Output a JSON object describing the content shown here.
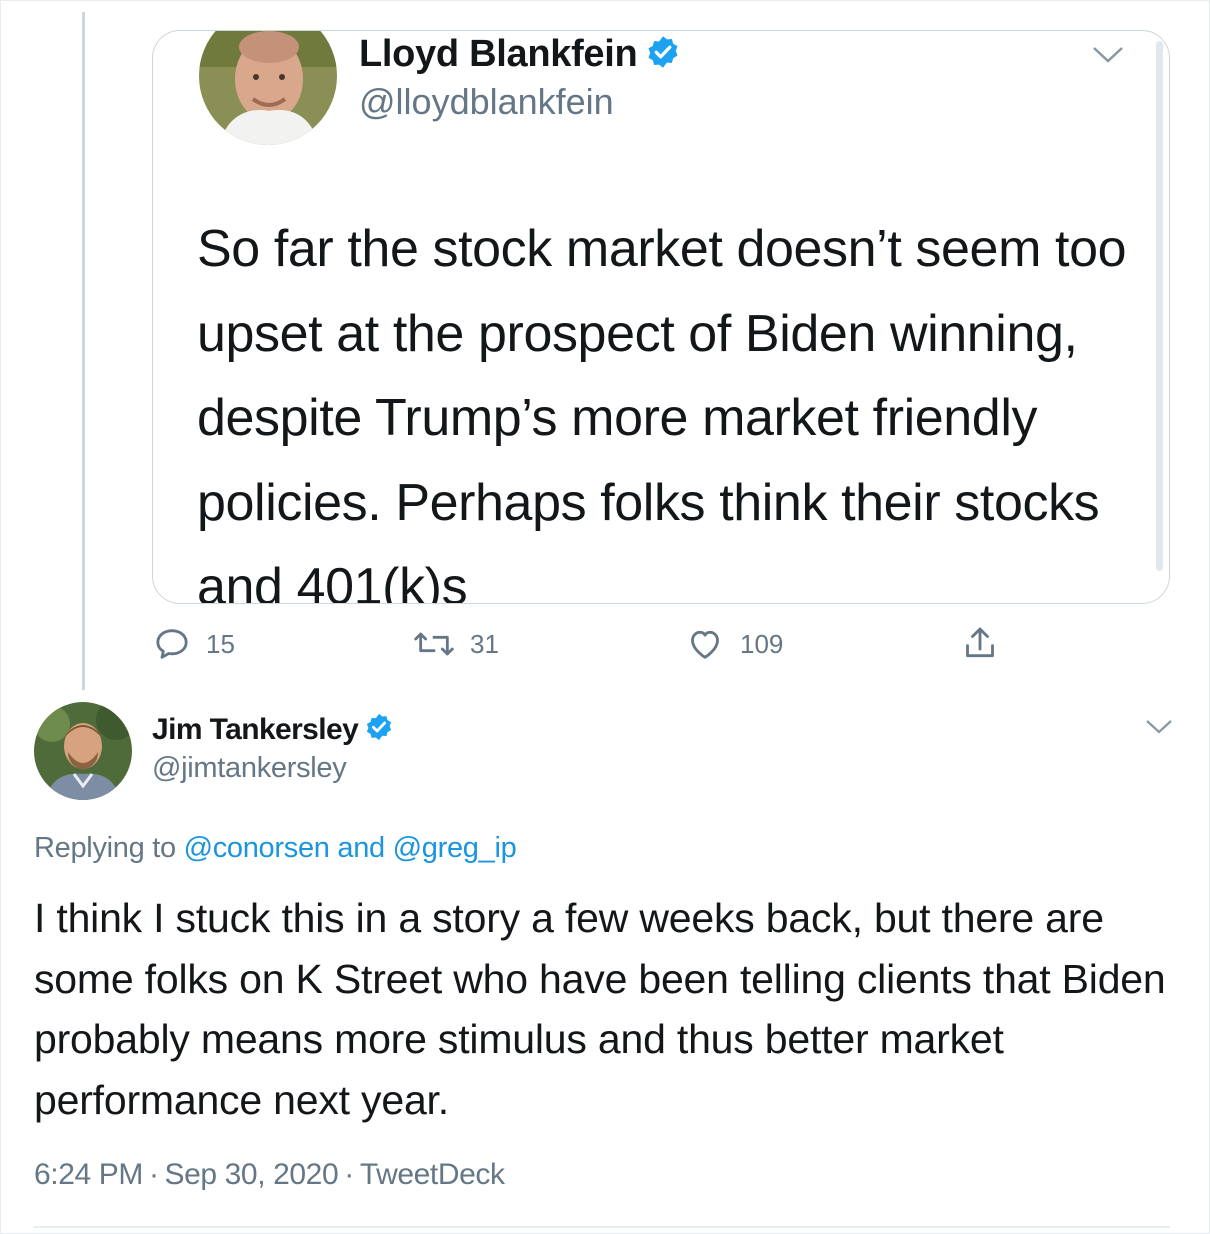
{
  "parent_tweet": {
    "author_name": "Lloyd Blankfein",
    "author_handle": "@lloydblankfein",
    "text": "So far the stock market doesn’t seem too upset at the prospect of Biden winning, despite Trump’s more market friendly policies. Perhaps folks think their stocks and 401(k)s",
    "reply_count": "15",
    "retweet_count": "31",
    "like_count": "109"
  },
  "reply_tweet": {
    "author_name": "Jim Tankersley",
    "author_handle": "@jimtankersley",
    "replying_prefix": "Replying to",
    "replying_mention_1": "@conorsen",
    "replying_and": "and",
    "replying_mention_2": "@greg_ip",
    "text": "I think I stuck this in a story a few weeks back, but there are some folks on K Street who have been telling clients that Biden probably means more stimulus and thus better market performance next year.",
    "time": "6:24 PM",
    "date": "Sep 30, 2020",
    "source": "TweetDeck",
    "separator": "·"
  },
  "colors": {
    "verified_blue": "#1da1f2",
    "link_blue": "#1b95e0",
    "secondary_text": "#657786",
    "border": "#ccd6dd"
  },
  "icons": [
    "verified-badge-icon",
    "chevron-down-icon",
    "reply-icon",
    "retweet-icon",
    "like-icon",
    "share-icon"
  ]
}
